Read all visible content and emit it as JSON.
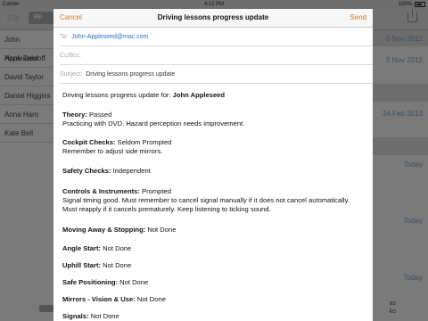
{
  "status_bar": {
    "carrier": "Carrier",
    "time": "4:12 PM",
    "battery": "100%"
  },
  "background": {
    "edit_label": "Edit",
    "segment_label": "Re",
    "contacts": [
      "John Appleseed",
      "Hank Zakroff",
      "David Taylor",
      "Daniel Higgins",
      "Anna Haro",
      "Kate Bell"
    ],
    "dates": [
      "5 Nov 2012",
      "5 Nov 2012",
      "24 Feb 2013",
      "Today",
      "Today",
      "Today"
    ],
    "bottom_text": [
      "as",
      "ko"
    ]
  },
  "sheet": {
    "cancel_label": "Cancel",
    "title": "Driving lessons progress update",
    "send_label": "Send",
    "to_label": "To:",
    "to_value": "John-Appleseed@mac.com",
    "ccbcc_label": "Cc/Bcc:",
    "subject_label": "Subject:",
    "subject_value": "Driving lessons progress update",
    "intro": "Driving lessons progress update for: ",
    "student": "John Appleseed",
    "sections": [
      {
        "label": "Theory:",
        "status": " Passed",
        "notes": [
          "Practicing with DVD. Hazard perception needs improvement."
        ]
      },
      {
        "label": "Cockpit Checks:",
        "status": " Seldom Prompted",
        "notes": [
          "Remember to adjust side mirrors."
        ]
      },
      {
        "label": "Safety Checks:",
        "status": " Independent",
        "notes": []
      },
      {
        "label": "Controls & Instruments:",
        "status": " Prompted",
        "notes": [
          "Signal timing good. Must remember to cancel signal manually if it does not cancel automatically.",
          "Must reapply if it cancels prematurely. Keep listening to ticking sound."
        ]
      },
      {
        "label": "Moving Away & Stopping:",
        "status": " Not Done",
        "notes": []
      },
      {
        "label": "Angle Start:",
        "status": " Not Done",
        "notes": []
      },
      {
        "label": "Uphill Start:",
        "status": " Not Done",
        "notes": []
      },
      {
        "label": "Safe Positioning:",
        "status": " Not Done",
        "notes": []
      },
      {
        "label": "Mirrors - Vision & Use:",
        "status": " Not Done",
        "notes": []
      },
      {
        "label": "Signals:",
        "status": " Not Done",
        "notes": []
      }
    ]
  }
}
